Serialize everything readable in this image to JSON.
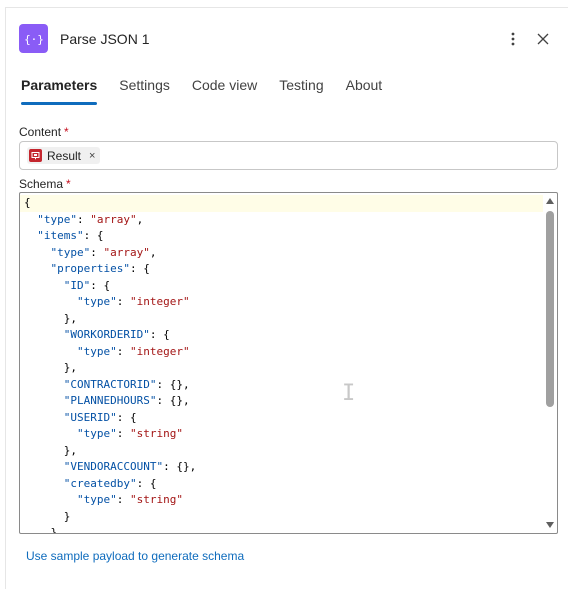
{
  "header": {
    "title": "Parse JSON 1",
    "app_icon_glyph": "{∵}",
    "accent_color": "#8a5cf6"
  },
  "tabs": [
    {
      "label": "Parameters",
      "active": true
    },
    {
      "label": "Settings",
      "active": false
    },
    {
      "label": "Code view",
      "active": false
    },
    {
      "label": "Testing",
      "active": false
    },
    {
      "label": "About",
      "active": false
    }
  ],
  "content_field": {
    "label": "Content",
    "required_mark": "*",
    "token_label": "Result",
    "token_remove": "×"
  },
  "schema_field": {
    "label": "Schema",
    "required_mark": "*"
  },
  "schema_lines": [
    [
      {
        "t": "p",
        "v": "{"
      }
    ],
    [
      {
        "t": "p",
        "v": "  "
      },
      {
        "t": "k",
        "v": "\"type\""
      },
      {
        "t": "p",
        "v": ": "
      },
      {
        "t": "s",
        "v": "\"array\""
      },
      {
        "t": "p",
        "v": ","
      }
    ],
    [
      {
        "t": "p",
        "v": "  "
      },
      {
        "t": "k",
        "v": "\"items\""
      },
      {
        "t": "p",
        "v": ": {"
      }
    ],
    [
      {
        "t": "p",
        "v": "    "
      },
      {
        "t": "k",
        "v": "\"type\""
      },
      {
        "t": "p",
        "v": ": "
      },
      {
        "t": "s",
        "v": "\"array\""
      },
      {
        "t": "p",
        "v": ","
      }
    ],
    [
      {
        "t": "p",
        "v": "    "
      },
      {
        "t": "k",
        "v": "\"properties\""
      },
      {
        "t": "p",
        "v": ": {"
      }
    ],
    [
      {
        "t": "p",
        "v": "      "
      },
      {
        "t": "k",
        "v": "\"ID\""
      },
      {
        "t": "p",
        "v": ": {"
      }
    ],
    [
      {
        "t": "p",
        "v": "        "
      },
      {
        "t": "k",
        "v": "\"type\""
      },
      {
        "t": "p",
        "v": ": "
      },
      {
        "t": "s",
        "v": "\"integer\""
      }
    ],
    [
      {
        "t": "p",
        "v": "      },"
      }
    ],
    [
      {
        "t": "p",
        "v": "      "
      },
      {
        "t": "k",
        "v": "\"WORKORDERID\""
      },
      {
        "t": "p",
        "v": ": {"
      }
    ],
    [
      {
        "t": "p",
        "v": "        "
      },
      {
        "t": "k",
        "v": "\"type\""
      },
      {
        "t": "p",
        "v": ": "
      },
      {
        "t": "s",
        "v": "\"integer\""
      }
    ],
    [
      {
        "t": "p",
        "v": "      },"
      }
    ],
    [
      {
        "t": "p",
        "v": "      "
      },
      {
        "t": "k",
        "v": "\"CONTRACTORID\""
      },
      {
        "t": "p",
        "v": ": {},"
      }
    ],
    [
      {
        "t": "p",
        "v": "      "
      },
      {
        "t": "k",
        "v": "\"PLANNEDHOURS\""
      },
      {
        "t": "p",
        "v": ": {},"
      }
    ],
    [
      {
        "t": "p",
        "v": "      "
      },
      {
        "t": "k",
        "v": "\"USERID\""
      },
      {
        "t": "p",
        "v": ": {"
      }
    ],
    [
      {
        "t": "p",
        "v": "        "
      },
      {
        "t": "k",
        "v": "\"type\""
      },
      {
        "t": "p",
        "v": ": "
      },
      {
        "t": "s",
        "v": "\"string\""
      }
    ],
    [
      {
        "t": "p",
        "v": "      },"
      }
    ],
    [
      {
        "t": "p",
        "v": "      "
      },
      {
        "t": "k",
        "v": "\"VENDORACCOUNT\""
      },
      {
        "t": "p",
        "v": ": {},"
      }
    ],
    [
      {
        "t": "p",
        "v": "      "
      },
      {
        "t": "k",
        "v": "\"createdby\""
      },
      {
        "t": "p",
        "v": ": {"
      }
    ],
    [
      {
        "t": "p",
        "v": "        "
      },
      {
        "t": "k",
        "v": "\"type\""
      },
      {
        "t": "p",
        "v": ": "
      },
      {
        "t": "s",
        "v": "\"string\""
      }
    ],
    [
      {
        "t": "p",
        "v": "      }"
      }
    ],
    [
      {
        "t": "p",
        "v": "    }"
      }
    ]
  ],
  "footer": {
    "sample_link": "Use sample payload to generate schema"
  },
  "colors": {
    "tab_indicator": "#0f6cbd",
    "link": "#0f6cbd",
    "token_icon": "#c4262e",
    "json_key": "#0451a5",
    "json_string": "#a31515"
  }
}
